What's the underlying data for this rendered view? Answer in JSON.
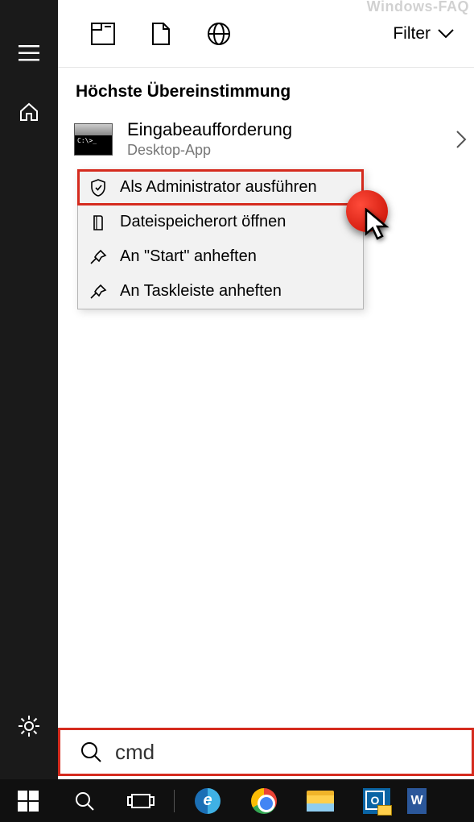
{
  "watermark": "Windows-FAQ",
  "toolbar": {
    "filter_label": "Filter"
  },
  "section": {
    "best_match": "Höchste Übereinstimmung"
  },
  "result": {
    "title": "Eingabeaufforderung",
    "subtitle": "Desktop-App"
  },
  "context_menu": {
    "items": [
      {
        "label": "Als Administrator ausführen",
        "icon": "shield-icon"
      },
      {
        "label": "Dateispeicherort öffnen",
        "icon": "folder-open-icon"
      },
      {
        "label": "An \"Start\" anheften",
        "icon": "pin-icon"
      },
      {
        "label": "An Taskleiste anheften",
        "icon": "pin-icon"
      }
    ]
  },
  "search": {
    "value": "cmd"
  },
  "taskbar": {
    "word_label": "W"
  }
}
